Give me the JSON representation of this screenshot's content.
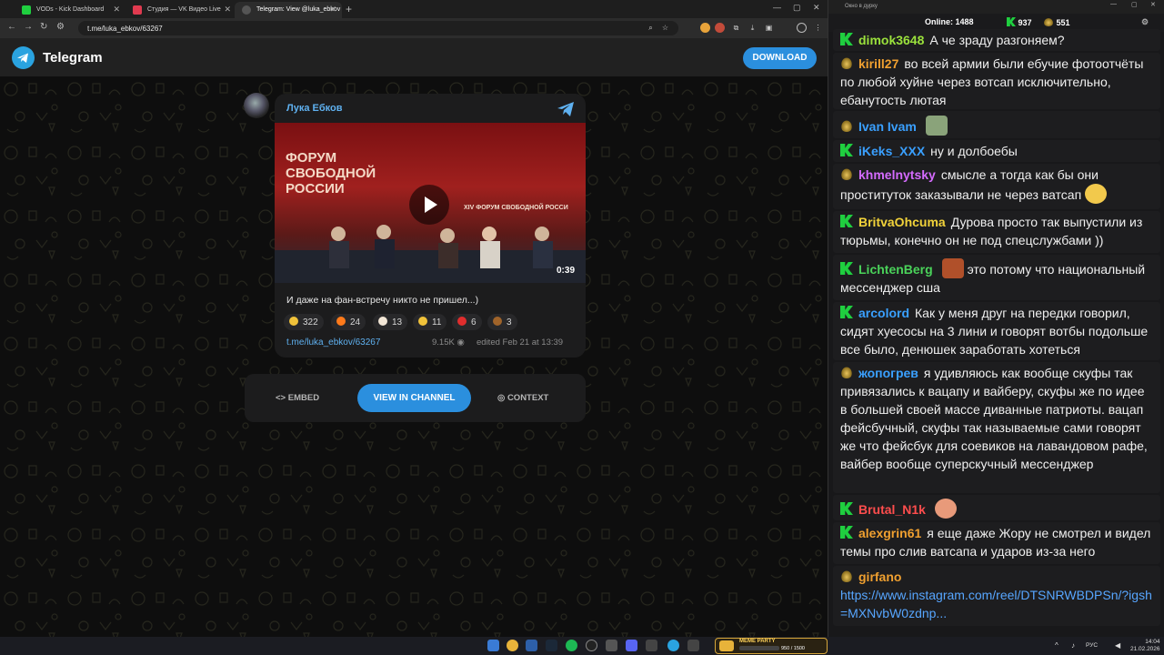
{
  "browser": {
    "tabs": [
      {
        "title": "VODs - Kick Dashboard",
        "favicon_color": "#1fcf3f"
      },
      {
        "title": "Студия — VK Видео Live",
        "favicon_color": "#e03a4f"
      },
      {
        "title": "Telegram: View @luka_ebkov",
        "favicon_color": "#3a3a3a"
      }
    ],
    "url": "t.me/luka_ebkov/63267"
  },
  "telegram": {
    "brand": "Telegram",
    "download_label": "DOWNLOAD",
    "channel_name": "Лука Ебков",
    "video": {
      "overlay_title": "ФОРУМ СВОБОДНОЙ РОССИИ",
      "banner_text": "XIV ФОРУМ СВОБОДНОЙ РОССИ",
      "duration": "0:39"
    },
    "caption": "И даже на фан-встречу никто не пришел...)",
    "reactions": [
      {
        "emoji": "laughing-face",
        "count": "322",
        "color": "#f0c23a"
      },
      {
        "emoji": "fire",
        "count": "24",
        "color": "#ff7a1a"
      },
      {
        "emoji": "clown-face",
        "count": "13",
        "color": "#f2e6d6"
      },
      {
        "emoji": "thumbs-up",
        "count": "11",
        "color": "#f0c23a"
      },
      {
        "emoji": "broken-heart",
        "count": "6",
        "color": "#e02d2d"
      },
      {
        "emoji": "poop",
        "count": "3",
        "color": "#a0642a"
      }
    ],
    "post_link": "t.me/luka_ebkov/63267",
    "views": "9.15K",
    "edited": "edited  Feb 21 at 13:39",
    "actions": {
      "embed": "EMBED",
      "view_in_channel": "VIEW IN CHANNEL",
      "context": "CONTEXT"
    }
  },
  "chat": {
    "window_title": "Окно в дурку",
    "online_label": "Online:",
    "online_count": "1488",
    "kick_count": "937",
    "other_count": "551",
    "messages": [
      {
        "badge": "kick",
        "user": "dimok3648",
        "color": "#9be23c",
        "text": "А че зраду разгоняем?"
      },
      {
        "badge": "hat",
        "user": "kirill27",
        "color": "#f0a030",
        "text": "во всей армии были ебучие фотоотчёты по любой хуйне через вотсап исключительно, ебанутость лютая"
      },
      {
        "badge": "hat",
        "user": "Ivan Ivam",
        "color": "#3aa0ff",
        "text": ""
      },
      {
        "badge": "kick",
        "user": "iKeks_XXX",
        "color": "#3aa0ff",
        "text": "ну и долбоебы"
      },
      {
        "badge": "hat",
        "user": "khmelnytsky",
        "color": "#d56bff",
        "text": "смысле а тогда как бы они проституток заказывали не через ватсап"
      },
      {
        "badge": "kick",
        "user": "BritvaOhcuma",
        "color": "#f2d33a",
        "text": "Дурова просто так выпустили из тюрьмы, конечно он не под спецслужбами ))"
      },
      {
        "badge": "kick",
        "user": "LichtenBerg",
        "color": "#4ad35a",
        "text": "это потому что национальный мессенджер сша"
      },
      {
        "badge": "kick",
        "user": "arcolord",
        "color": "#3aa0ff",
        "text": "Как у меня друг на передки говорил, сидят хуесосы на 3 лини и говорят вотбы подольше все было, денюшек заработать хотеться"
      },
      {
        "badge": "hat",
        "user": "жопогрев",
        "color": "#3aa0ff",
        "text": "я удивляюсь как вообще скуфы так привязались к вацапу и вайберу, скуфы же по идее в большей своей массе диванные патриоты. вацап фейсбучный, скуфы так называемые сами говорят же что фейсбук для соевиков на лавандовом рафе, вайбер вообще суперскучный мессенджер"
      },
      {
        "badge": "kick",
        "user": "Brutal_N1k",
        "color": "#ff4d4d",
        "text": ""
      },
      {
        "badge": "kick",
        "user": "alexgrin61",
        "color": "#f0a030",
        "text": "я еще даже Жору не смотрел и видел темы про слив ватсапа и ударов из-за него"
      },
      {
        "badge": "hat",
        "user": "girfano",
        "color": "#f0a030",
        "text": "",
        "link": "https://www.instagram.com/reel/DTSNRWBDPSn/?igsh=MXNvbW0zdnp..."
      }
    ]
  },
  "taskbar": {
    "meme_label": "MEME PARTY",
    "meme_count": "950 / 1500",
    "lang": "РУС",
    "time": "14:04",
    "date": "21.02.2026"
  }
}
